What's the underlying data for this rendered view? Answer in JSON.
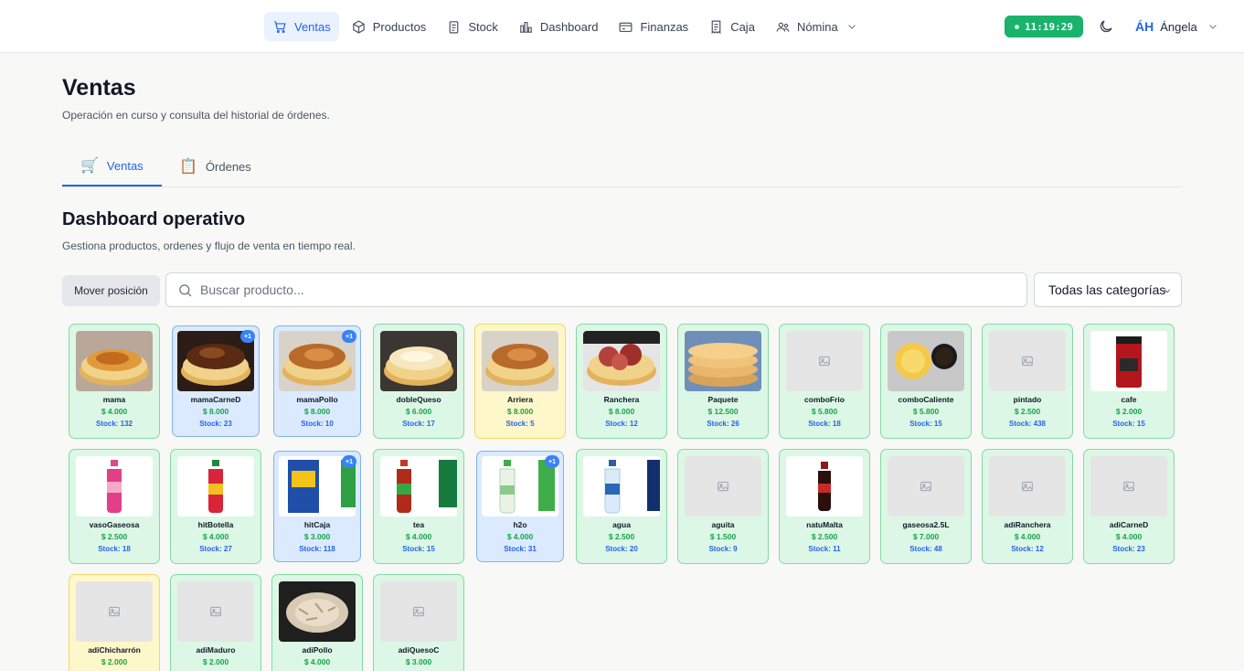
{
  "nav": {
    "items": [
      {
        "label": "Ventas",
        "icon": "cart-icon",
        "active": true
      },
      {
        "label": "Productos",
        "icon": "box-icon"
      },
      {
        "label": "Stock",
        "icon": "clipboard-icon"
      },
      {
        "label": "Dashboard",
        "icon": "chart-icon"
      },
      {
        "label": "Finanzas",
        "icon": "card-icon"
      },
      {
        "label": "Caja",
        "icon": "receipt-icon"
      },
      {
        "label": "Nómina",
        "icon": "users-icon",
        "dropdown": true
      }
    ],
    "clock": "11:19:29",
    "user_initials": "ÁH",
    "user_name": "Ángela"
  },
  "header": {
    "title": "Ventas",
    "subtitle": "Operación en curso y consulta del historial de órdenes."
  },
  "tabs": [
    {
      "label": "Ventas",
      "icon": "🛒",
      "active": true
    },
    {
      "label": "Órdenes",
      "icon": "📋"
    }
  ],
  "section": {
    "title": "Dashboard operativo",
    "subtitle": "Gestiona productos, ordenes y flujo de venta en tiempo real."
  },
  "toolbar": {
    "move_label": "Mover posición",
    "search_placeholder": "Buscar producto...",
    "category_selected": "Todas las categorías"
  },
  "colors": {
    "accent": "#2563eb",
    "success": "#16a34a",
    "clock_bg": "#19b36b"
  },
  "products": [
    {
      "name": "mama",
      "price": "$ 4.000",
      "stock": "Stock: 132",
      "tone": "green",
      "img": "arepa"
    },
    {
      "name": "mamaCarneD",
      "price": "$ 8.000",
      "stock": "Stock: 23",
      "tone": "blue",
      "badge": "+1",
      "img": "arepa-meat"
    },
    {
      "name": "mamaPollo",
      "price": "$ 8.000",
      "stock": "Stock: 10",
      "tone": "blue",
      "badge": "+1",
      "img": "arepa-chicken"
    },
    {
      "name": "dobleQueso",
      "price": "$ 6.000",
      "stock": "Stock: 17",
      "tone": "green",
      "img": "arepa-cheese"
    },
    {
      "name": "Arriera",
      "price": "$ 8.000",
      "stock": "Stock: 5",
      "tone": "yellow",
      "img": "arepa-chicken"
    },
    {
      "name": "Ranchera",
      "price": "$ 8.000",
      "stock": "Stock: 12",
      "tone": "green",
      "img": "arepa-sausage"
    },
    {
      "name": "Paquete",
      "price": "$ 12.500",
      "stock": "Stock: 26",
      "tone": "green",
      "img": "arepa-stack"
    },
    {
      "name": "comboFrio",
      "price": "$ 5.800",
      "stock": "Stock: 18",
      "tone": "green",
      "img": "placeholder"
    },
    {
      "name": "comboCaliente",
      "price": "$ 5.800",
      "stock": "Stock: 15",
      "tone": "green",
      "img": "combo-hot"
    },
    {
      "name": "pintado",
      "price": "$ 2.500",
      "stock": "Stock: 438",
      "tone": "green",
      "img": "placeholder"
    },
    {
      "name": "cafe",
      "price": "$ 2.000",
      "stock": "Stock: 15",
      "tone": "green",
      "img": "coffee-bag"
    },
    {
      "name": "vasoGaseosa",
      "price": "$ 2.500",
      "stock": "Stock: 18",
      "tone": "green",
      "img": "bottle-pink"
    },
    {
      "name": "hitBotella",
      "price": "$ 4.000",
      "stock": "Stock: 27",
      "tone": "green",
      "img": "bottle-red"
    },
    {
      "name": "hitCaja",
      "price": "$ 3.000",
      "stock": "Stock: 118",
      "tone": "blue",
      "badge": "+1",
      "img": "juice-box"
    },
    {
      "name": "tea",
      "price": "$ 4.000",
      "stock": "Stock: 15",
      "tone": "green",
      "img": "bottle-tea"
    },
    {
      "name": "h2o",
      "price": "$ 4.000",
      "stock": "Stock: 31",
      "tone": "blue",
      "badge": "+1",
      "img": "bottle-h2o"
    },
    {
      "name": "agua",
      "price": "$ 2.500",
      "stock": "Stock: 20",
      "tone": "green",
      "img": "bottle-water"
    },
    {
      "name": "aguita",
      "price": "$ 1.500",
      "stock": "Stock: 9",
      "tone": "green",
      "img": "placeholder"
    },
    {
      "name": "natuMalta",
      "price": "$ 2.500",
      "stock": "Stock: 11",
      "tone": "green",
      "img": "bottle-malta"
    },
    {
      "name": "gaseosa2.5L",
      "price": "$ 7.000",
      "stock": "Stock: 48",
      "tone": "green",
      "img": "placeholder"
    },
    {
      "name": "adiRanchera",
      "price": "$ 4.000",
      "stock": "Stock: 12",
      "tone": "green",
      "img": "placeholder"
    },
    {
      "name": "adiCarneD",
      "price": "$ 4.000",
      "stock": "Stock: 23",
      "tone": "green",
      "img": "placeholder"
    },
    {
      "name": "adiChicharrón",
      "price": "$ 2.000",
      "stock": "",
      "tone": "yellow",
      "img": "placeholder"
    },
    {
      "name": "adiMaduro",
      "price": "$ 2.000",
      "stock": "",
      "tone": "green",
      "img": "placeholder"
    },
    {
      "name": "adiPollo",
      "price": "$ 4.000",
      "stock": "",
      "tone": "green",
      "img": "shredded-chicken"
    },
    {
      "name": "adiQuesoC",
      "price": "$ 3.000",
      "stock": "",
      "tone": "green",
      "img": "placeholder"
    }
  ]
}
